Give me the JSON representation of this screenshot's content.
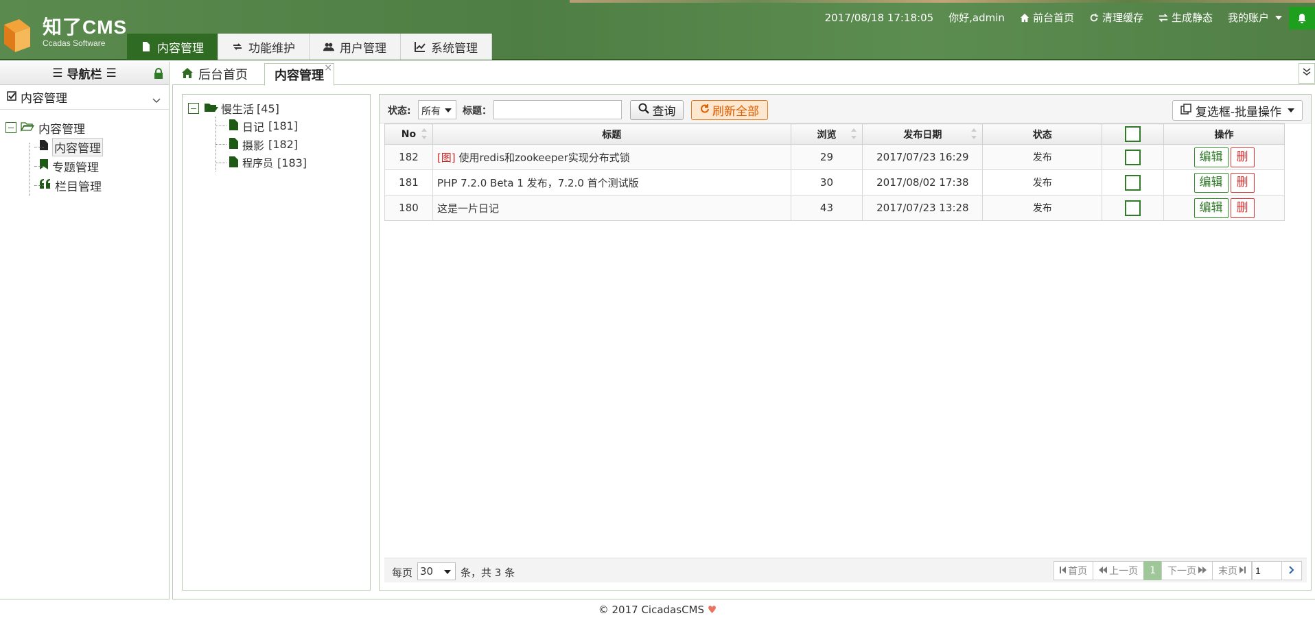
{
  "app": {
    "logo_text": "知了CMS",
    "logo_sub": "Ccadas Software"
  },
  "main_tabs": [
    {
      "label": "内容管理",
      "icon": "file-icon",
      "active": true
    },
    {
      "label": "功能维护",
      "icon": "retweet-icon",
      "active": false
    },
    {
      "label": "用户管理",
      "icon": "users-icon",
      "active": false
    },
    {
      "label": "系统管理",
      "icon": "chart-icon",
      "active": false
    }
  ],
  "topbar": {
    "datetime": "2017/08/18 17:18:05",
    "greeting": "你好,admin",
    "home": "前台首页",
    "clear_cache": "清理缓存",
    "gen_static": "生成静态",
    "account": "我的账户"
  },
  "sidebar": {
    "title": "导航栏",
    "section": "内容管理",
    "tree_root": "内容管理",
    "items": [
      "内容管理",
      "专题管理",
      "栏目管理"
    ]
  },
  "content_tabs": {
    "home": "后台首页",
    "active": "内容管理",
    "close": "×"
  },
  "categories": {
    "root": {
      "name": "慢生活",
      "count": "[45]"
    },
    "children": [
      {
        "name": "日记",
        "count": "[181]"
      },
      {
        "name": "摄影",
        "count": "[182]"
      },
      {
        "name": "程序员",
        "count": "[183]"
      }
    ]
  },
  "toolbar": {
    "status_label": "状态:",
    "status_value": "所有",
    "title_label": "标题：",
    "title_value": "",
    "query": "查询",
    "refresh": "刷新全部",
    "batch": "复选框-批量操作"
  },
  "grid": {
    "headers": {
      "no": "No",
      "title": "标题",
      "views": "浏览",
      "date": "发布日期",
      "status": "状态",
      "ops": "操作"
    },
    "rows": [
      {
        "no": "182",
        "tag": "[图]",
        "title": "使用redis和zookeeper实现分布式锁",
        "views": "29",
        "date": "2017/07/23 16:29",
        "status": "发布",
        "edit": "编辑",
        "del": "删"
      },
      {
        "no": "181",
        "tag": "",
        "title": "PHP 7.2.0 Beta 1 发布，7.2.0 首个测试版",
        "views": "30",
        "date": "2017/08/02 17:38",
        "status": "发布",
        "edit": "编辑",
        "del": "删"
      },
      {
        "no": "180",
        "tag": "",
        "title": "这是一片日记",
        "views": "43",
        "date": "2017/07/23 13:28",
        "status": "发布",
        "edit": "编辑",
        "del": "删"
      }
    ]
  },
  "pager": {
    "per_page_label": "每页",
    "per_page": "30",
    "total_text": "条，共 3 条",
    "first": "首页",
    "prev": "上一页",
    "current": "1",
    "next": "下一页",
    "last": "末页",
    "page_input": "1"
  },
  "footer": {
    "text": "© 2017 CicadasCMS"
  },
  "colors": {
    "header_green": "#4f7e44",
    "active_tab": "#2f6b22",
    "link_green": "#2d6a2a",
    "danger": "#d33333",
    "refresh_orange": "#e05e00"
  }
}
